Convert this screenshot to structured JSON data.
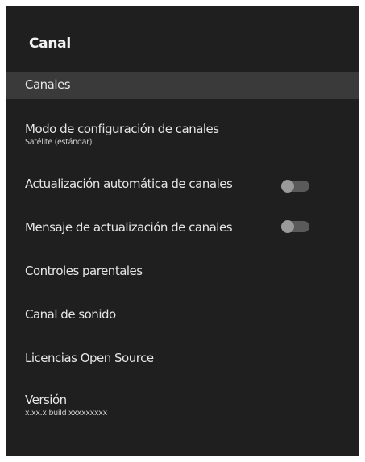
{
  "panel": {
    "title": "Canal"
  },
  "menu": {
    "items": [
      {
        "label": "Canales",
        "selected": true
      },
      {
        "label": "Modo de configuración de canales",
        "sub": "Satélite (estándar)"
      },
      {
        "label": "Actualización automática de canales",
        "toggle_state": "off"
      },
      {
        "label": "Mensaje de actualización de canales",
        "toggle_state": "off"
      },
      {
        "label": "Controles parentales"
      },
      {
        "label": "Canal de sonido"
      },
      {
        "label": "Licencias Open Source"
      },
      {
        "label": "Versión",
        "sub": "x.xx.x build xxxxxxxxx"
      }
    ]
  }
}
